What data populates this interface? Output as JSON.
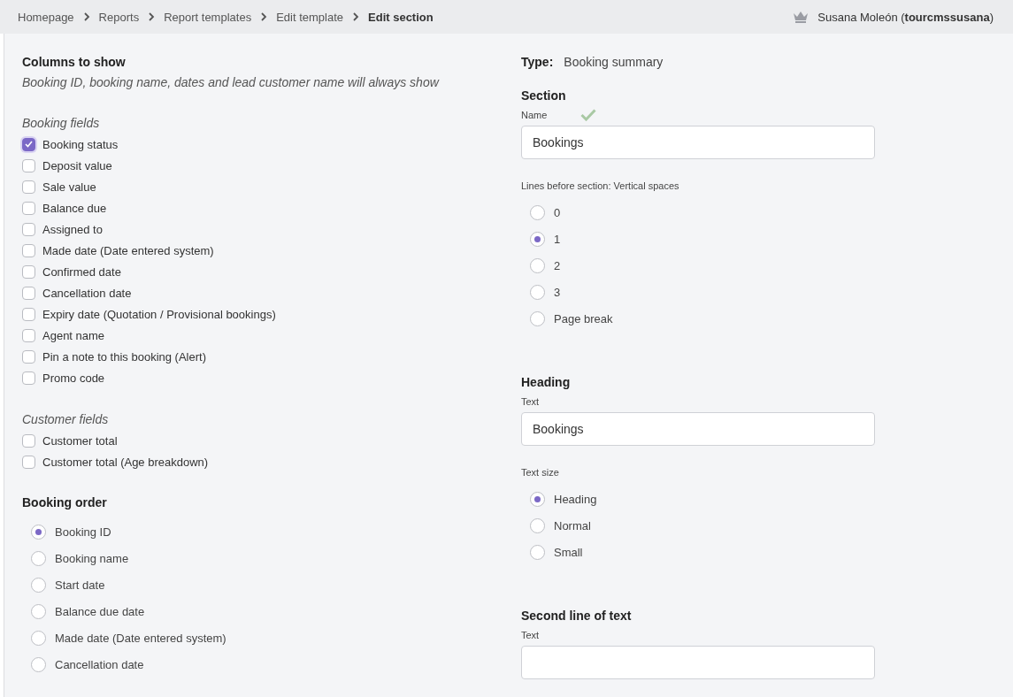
{
  "breadcrumbs": [
    {
      "label": "Homepage",
      "current": false
    },
    {
      "label": "Reports",
      "current": false
    },
    {
      "label": "Report templates",
      "current": false
    },
    {
      "label": "Edit template",
      "current": false
    },
    {
      "label": "Edit section",
      "current": true
    }
  ],
  "user": {
    "name": "Susana Moleón (**tourcmssusana**)"
  },
  "columns": {
    "title": "Columns to show",
    "note": "Booking ID, booking name, dates and lead customer name will always show",
    "groups": [
      {
        "title": "Booking fields",
        "items": [
          {
            "label": "Booking status",
            "checked": true
          },
          {
            "label": "Deposit value",
            "checked": false
          },
          {
            "label": "Sale value",
            "checked": false
          },
          {
            "label": "Balance due",
            "checked": false
          },
          {
            "label": "Assigned to",
            "checked": false
          },
          {
            "label": "Made date (Date entered system)",
            "checked": false
          },
          {
            "label": "Confirmed date",
            "checked": false
          },
          {
            "label": "Cancellation date",
            "checked": false
          },
          {
            "label": "Expiry date (Quotation / Provisional bookings)",
            "checked": false
          },
          {
            "label": "Agent name",
            "checked": false
          },
          {
            "label": "Pin a note to this booking (Alert)",
            "checked": false
          },
          {
            "label": "Promo code",
            "checked": false
          }
        ]
      },
      {
        "title": "Customer fields",
        "items": [
          {
            "label": "Customer total",
            "checked": false
          },
          {
            "label": "Customer total (Age breakdown)",
            "checked": false
          }
        ]
      }
    ]
  },
  "booking_order": {
    "title": "Booking order",
    "options": [
      {
        "label": "Booking ID",
        "selected": true
      },
      {
        "label": "Booking name",
        "selected": false
      },
      {
        "label": "Start date",
        "selected": false
      },
      {
        "label": "Balance due date",
        "selected": false
      },
      {
        "label": "Made date (Date entered system)",
        "selected": false
      },
      {
        "label": "Cancellation date",
        "selected": false
      }
    ]
  },
  "type": {
    "label": "Type:",
    "value": "Booking summary"
  },
  "section": {
    "title": "Section",
    "name_label": "Name",
    "name_valid": true,
    "name_value": "Bookings",
    "lines_label": "Lines before section: Vertical spaces",
    "lines_options": [
      {
        "label": "0",
        "selected": false
      },
      {
        "label": "1",
        "selected": true
      },
      {
        "label": "2",
        "selected": false
      },
      {
        "label": "3",
        "selected": false
      },
      {
        "label": "Page break",
        "selected": false
      }
    ]
  },
  "heading": {
    "title": "Heading",
    "text_label": "Text",
    "text_value": "Bookings",
    "size_label": "Text size",
    "size_options": [
      {
        "label": "Heading",
        "selected": true
      },
      {
        "label": "Normal",
        "selected": false
      },
      {
        "label": "Small",
        "selected": false
      }
    ]
  },
  "second_line": {
    "title": "Second line of text",
    "text_label": "Text"
  }
}
